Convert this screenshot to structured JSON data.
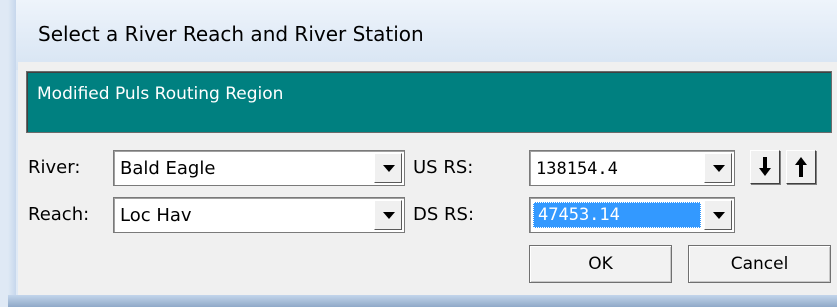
{
  "window": {
    "title": "Select a River Reach and River Station"
  },
  "region_label": "Modified Puls Routing Region",
  "river": {
    "label": "River:",
    "value": "Bald Eagle"
  },
  "reach": {
    "label": "Reach:",
    "value": "Loc Hav"
  },
  "us_rs": {
    "label": "US RS:",
    "value": "138154.4"
  },
  "ds_rs": {
    "label": "DS RS:",
    "value": "47453.14"
  },
  "buttons": {
    "ok": "OK",
    "cancel": "Cancel"
  },
  "icons": {
    "dropdown": "chevron-down-icon",
    "down": "arrow-down-icon",
    "up": "arrow-up-icon"
  }
}
